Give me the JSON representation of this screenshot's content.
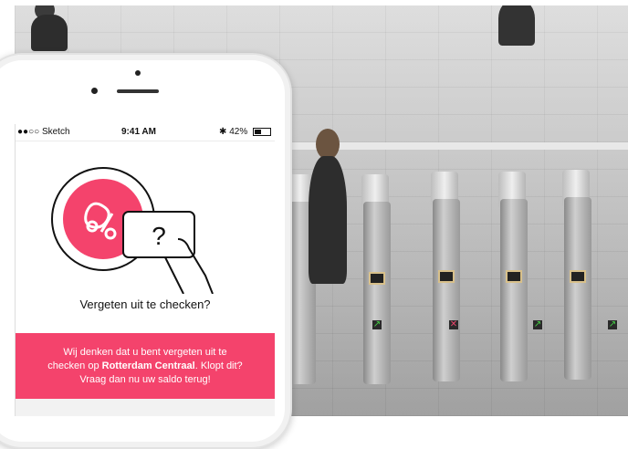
{
  "statusbar": {
    "carrier": "●●○○ Sketch",
    "time": "9:41 AM",
    "battery": "42%"
  },
  "card": {
    "question_mark": "?",
    "icon": "percent-badge-icon"
  },
  "title": "Vergeten uit te checken?",
  "banner": {
    "line1": "Wij denken dat u bent vergeten uit te",
    "line2_prefix": "checken op ",
    "station": "Rotterdam Centraal",
    "line2_suffix": ". Klopt dit?",
    "line3": "Vraag dan nu uw saldo terug!"
  },
  "colors": {
    "accent": "#f4436c",
    "text": "#111111"
  }
}
